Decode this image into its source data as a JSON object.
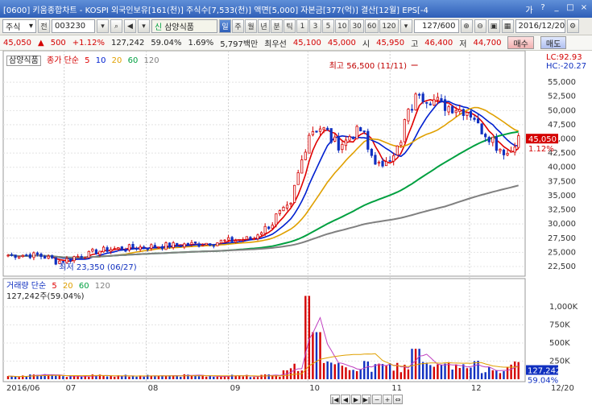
{
  "window": {
    "title": "[0600] 키움종합차트 - KOSPI  외국인보유[161(천)]  주식수[7,533(천)]  액면[5,000]  자본금[377(억)]  결산[12월]  EPS[-4"
  },
  "toolbar": {
    "market": "주식",
    "prev_label": "전",
    "code": "003230",
    "stock_name": "삼양식품",
    "period_tabs": [
      "일",
      "주",
      "월",
      "년",
      "분",
      "틱",
      "1",
      "3",
      "5",
      "10",
      "30",
      "60",
      "120"
    ],
    "selected_period": "일",
    "count": "127",
    "count_total": "/600",
    "date": "2016/12/20"
  },
  "pricebar": {
    "price": "45,050",
    "change_arrow": "▲",
    "change": "500",
    "change_pct": "+1.12%",
    "volume": "127,242",
    "ratio1": "59.04%",
    "ratio2": "1.69%",
    "amount": "5,797백만",
    "best_ask_label": "최우선",
    "best_ask": "45,100",
    "best_bid": "45,000",
    "open_label": "시",
    "open": "45,950",
    "high_label": "고",
    "high": "46,400",
    "low_label": "저",
    "low": "44,700",
    "buy_label": "매수",
    "sell_label": "매도"
  },
  "price_panel": {
    "legend_name": "삼양식품",
    "legend_ma_title": "종가 단순",
    "legend_ma_periods": [
      "5",
      "10",
      "20",
      "60",
      "120"
    ],
    "lc": "LC:92.93",
    "hc": "HC:-20.27",
    "max_annotation": "최고 56,500 (11/11)",
    "min_annotation": "최저 23,350 (06/27)",
    "current_price_tag": "45,050",
    "current_pct_tag": "1.12%"
  },
  "volume_panel": {
    "legend_title": "거래량 단순",
    "legend_periods": [
      "5",
      "20",
      "60",
      "120"
    ],
    "current_volume_text": "127,242주(59.04%)",
    "volume_tag": "127,242",
    "pct_tag": "59.04%"
  },
  "x_axis": {
    "labels": [
      "2016/06",
      "07",
      "08",
      "09",
      "10",
      "11",
      "12",
      "12/20"
    ]
  },
  "colors": {
    "up": "#d40000",
    "down": "#1030c0",
    "ma5": "#e00000",
    "ma10": "#0020d0",
    "ma20": "#e0a000",
    "ma60": "#00a040",
    "ma120": "#808080"
  },
  "chart_data": {
    "type": "line",
    "title": "",
    "price_axis": {
      "ticks": [
        "55,000",
        "52,500",
        "50,000",
        "47,500",
        "45,000",
        "42,500",
        "40,000",
        "37,500",
        "35,000",
        "32,500",
        "30,000",
        "27,500",
        "25,000",
        "22,500"
      ],
      "ylim": [
        21500,
        58000
      ]
    },
    "volume_axis": {
      "ticks": [
        "1,000K",
        "750K",
        "500K",
        "250K"
      ],
      "ylim": [
        0,
        1200000
      ]
    },
    "months": [
      "2016/06",
      "07",
      "08",
      "09",
      "10",
      "11",
      "12",
      "12/20"
    ],
    "close_approx": [
      {
        "date": "2016/06/20",
        "price": 24500
      },
      {
        "date": "2016/06/27",
        "price": 23350
      },
      {
        "date": "2016/07/15",
        "price": 25500
      },
      {
        "date": "2016/08/01",
        "price": 26000
      },
      {
        "date": "2016/08/20",
        "price": 26500
      },
      {
        "date": "2016/09/10",
        "price": 27500
      },
      {
        "date": "2016/09/25",
        "price": 34000
      },
      {
        "date": "2016/09/30",
        "price": 46000
      },
      {
        "date": "2016/10/05",
        "price": 47000
      },
      {
        "date": "2016/10/12",
        "price": 44000
      },
      {
        "date": "2016/10/20",
        "price": 46500
      },
      {
        "date": "2016/10/28",
        "price": 39500
      },
      {
        "date": "2016/11/04",
        "price": 44000
      },
      {
        "date": "2016/11/11",
        "price": 53500
      },
      {
        "date": "2016/11/20",
        "price": 51000
      },
      {
        "date": "2016/11/30",
        "price": 50000
      },
      {
        "date": "2016/12/08",
        "price": 45500
      },
      {
        "date": "2016/12/15",
        "price": 42500
      },
      {
        "date": "2016/12/20",
        "price": 45050
      }
    ],
    "series": [
      {
        "name": "5",
        "values_hint": "ma"
      },
      {
        "name": "10",
        "values_hint": "ma"
      },
      {
        "name": "20",
        "values_hint": "ma"
      },
      {
        "name": "60",
        "values_hint": "ma"
      },
      {
        "name": "120",
        "values_hint": "ma"
      }
    ],
    "volume_peaks": [
      {
        "date": "2016/09/30",
        "volume": 1150000
      },
      {
        "date": "2016/10/04",
        "volume": 650000
      },
      {
        "date": "2016/11/10",
        "volume": 420000
      }
    ]
  }
}
